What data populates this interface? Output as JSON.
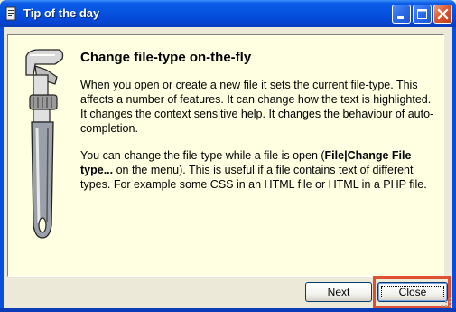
{
  "window": {
    "title": "Tip of the day"
  },
  "tip": {
    "heading": "Change file-type on-the-fly",
    "paragraph1": "When you open or create a new file it sets the current file-type. This affects a number of features. It can change how the text is highlighted. It changes the context sensitive help. It changes the behaviour of auto-completion.",
    "paragraph2_before": "You can change the file-type while a file is open (",
    "paragraph2_bold": "File|Change File type...",
    "paragraph2_after": " on the menu). This is useful if a file contains text of different types. For example some CSS in an HTML file or HTML in a PHP file."
  },
  "buttons": {
    "next_label": "Next",
    "close_label": "Close"
  },
  "colors": {
    "titlebar": "#0553e0",
    "panel_bg": "#ffffe1",
    "highlight": "#e05030"
  },
  "icons": {
    "app": "app-icon",
    "illustration": "wrench-icon",
    "minimize": "minimize-icon",
    "maximize": "maximize-icon",
    "close": "close-icon"
  }
}
